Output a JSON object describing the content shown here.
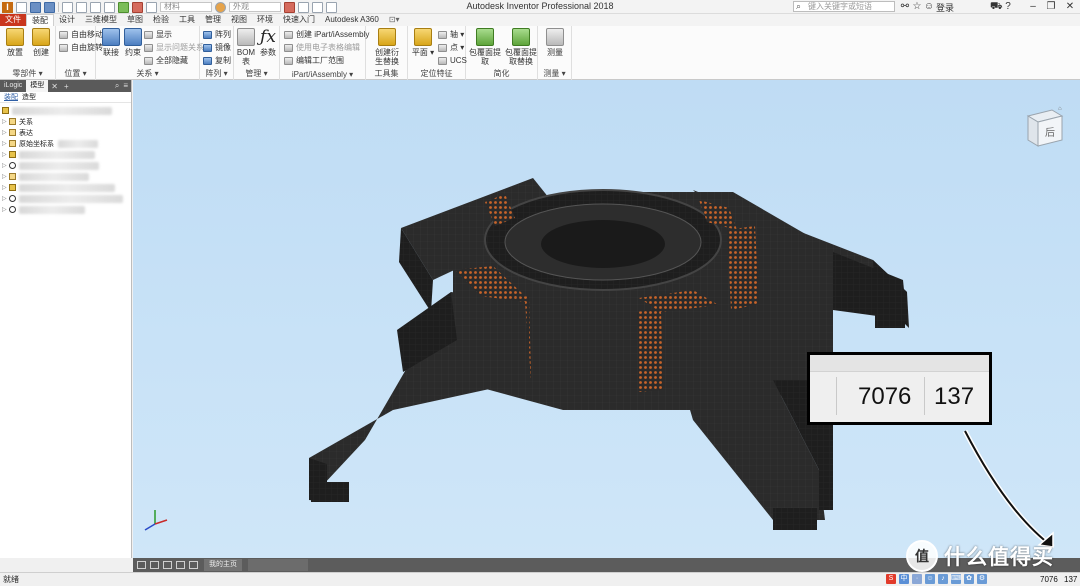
{
  "app": {
    "title": "Autodesk Inventor Professional 2018",
    "search_placeholder": "键入关键字或短语",
    "login_label": "登录",
    "material_field": "材料",
    "appearance_field": "外观"
  },
  "tabs": [
    {
      "label": "文件"
    },
    {
      "label": "装配"
    },
    {
      "label": "设计"
    },
    {
      "label": "三维模型"
    },
    {
      "label": "草图"
    },
    {
      "label": "检验"
    },
    {
      "label": "工具"
    },
    {
      "label": "管理"
    },
    {
      "label": "视图"
    },
    {
      "label": "环境"
    },
    {
      "label": "快速入门"
    },
    {
      "label": "Autodesk A360"
    }
  ],
  "ribbon": {
    "component": {
      "label": "零部件",
      "place": "放置",
      "create": "创建"
    },
    "position": {
      "label": "位置",
      "free_move": "自由移动",
      "free_rotate": "自由旋转"
    },
    "relationships": {
      "label": "关系",
      "joint": "联接",
      "constrain": "约束",
      "show": "显示",
      "show_problem": "显示问题关系",
      "hide_all": "全部隐藏"
    },
    "pattern": {
      "label": "阵列",
      "pattern": "阵列",
      "mirror": "镜像",
      "copy": "复制"
    },
    "manage": {
      "label": "管理",
      "bom": "BOM表",
      "params": "参数"
    },
    "productivity": {
      "label": "iPart/iAssembly",
      "create_ipart": "创建 iPart/iAssembly",
      "edit_spreadsheet": "使用电子表格编辑",
      "edit_factory": "编辑工厂范围"
    },
    "tools": {
      "label": "工具集",
      "derive": "创建衍生替换"
    },
    "work_features": {
      "label": "定位特征",
      "plane": "平面",
      "axis": "轴",
      "point": "点",
      "ucs": "UCS"
    },
    "simplification": {
      "label": "简化",
      "shrinkwrap": "包覆面提取",
      "shrinkwrap_sub": "包覆面提取替换"
    },
    "measure": {
      "label": "测量",
      "measure": "测量"
    }
  },
  "browser": {
    "tabs": [
      "iLogic",
      "模型"
    ],
    "subtabs": [
      "装配",
      "造型"
    ],
    "nodes": [
      {
        "label": "关系",
        "icon": "folder-icon"
      },
      {
        "label": "表达",
        "icon": "folder-icon"
      },
      {
        "label": "原始坐标系",
        "icon": "folder-icon"
      }
    ]
  },
  "doc_tabs": {
    "home": "我的主页"
  },
  "status": {
    "text": "就绪",
    "occurrences": "7076",
    "files": "137"
  },
  "callout": {
    "occurrences": "7076",
    "files": "137"
  },
  "watermark": {
    "logo": "值",
    "text": "什么值得买"
  },
  "viewcube": {
    "face_label": "后"
  },
  "colors": {
    "file_tab": "#c9361d",
    "viewport_top": "#bfdcf4",
    "model": "#2b2b2b",
    "highlight": "#c8642a"
  }
}
